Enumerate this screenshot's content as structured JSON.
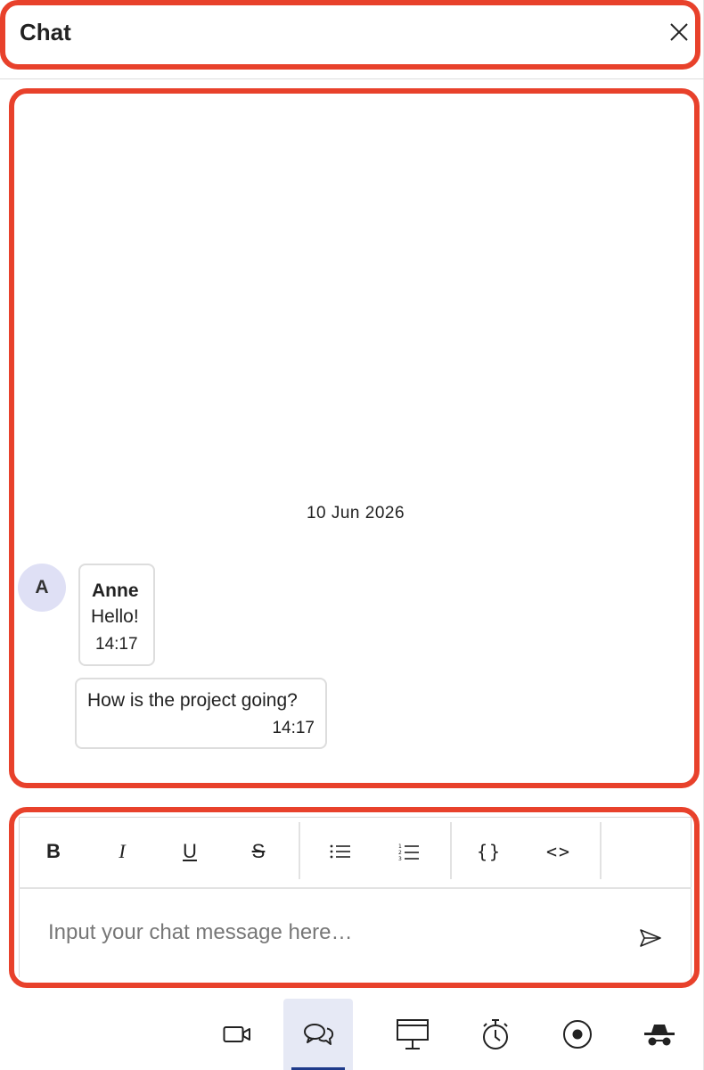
{
  "header": {
    "title": "Chat",
    "close_icon": "close-icon"
  },
  "messages": {
    "date_separator": "10 Jun 2026",
    "avatar_initial": "A",
    "avatar_color": "#dfe0f5",
    "items": [
      {
        "sender": "Anne",
        "text": "Hello!",
        "time": "14:17"
      },
      {
        "text": "How is the project going?",
        "time": "14:17"
      }
    ]
  },
  "composer": {
    "toolbar": {
      "bold": "B",
      "italic": "I",
      "underline": "U",
      "strikethrough": "S",
      "bullet_list_icon": "bullet-list-icon",
      "numbered_list_icon": "numbered-list-icon",
      "code_block": "{}",
      "inline_code": "<>"
    },
    "placeholder": "Input your chat message here…",
    "value": "",
    "send_icon": "send-icon"
  },
  "bottom_bar": {
    "items": [
      {
        "name": "video-icon",
        "active": false
      },
      {
        "name": "chat-icon",
        "active": true
      },
      {
        "name": "presentation-icon",
        "active": false
      },
      {
        "name": "timer-icon",
        "active": false
      },
      {
        "name": "record-icon",
        "active": false
      },
      {
        "name": "incognito-icon",
        "active": false
      }
    ],
    "active_color": "#1e3a8a"
  },
  "highlight_color": "#e8412b"
}
